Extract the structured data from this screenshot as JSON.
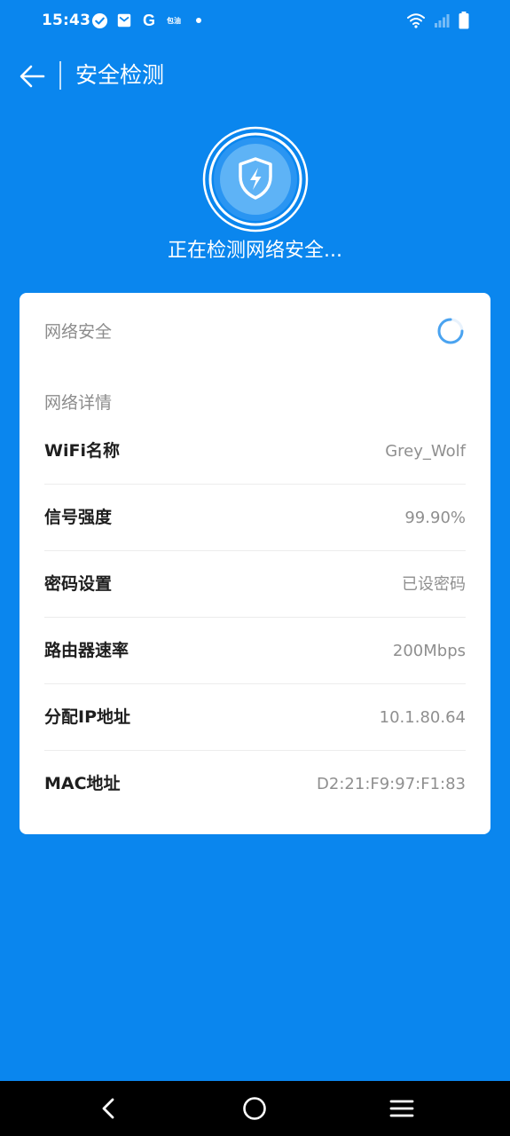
{
  "status_bar": {
    "time": "15:43",
    "notif_g_letter": "G",
    "notif_small_text": "包油"
  },
  "header": {
    "title": "安全检测"
  },
  "hero": {
    "message": "正在检测网络安全..."
  },
  "card": {
    "network_security_label": "网络安全",
    "network_details_label": "网络详情",
    "rows": [
      {
        "label": "WiFi名称",
        "value": "Grey_Wolf"
      },
      {
        "label": "信号强度",
        "value": "99.90%"
      },
      {
        "label": "密码设置",
        "value": "已设密码"
      },
      {
        "label": "路由器速率",
        "value": "200Mbps"
      },
      {
        "label": "分配IP地址",
        "value": "10.1.80.64"
      },
      {
        "label": "MAC地址",
        "value": "D2:21:F9:97:F1:83"
      }
    ]
  },
  "colors": {
    "background": "#0a86ee",
    "card": "#ffffff",
    "spinner": "#4aa3f0"
  },
  "icons": {
    "back": "arrow-left-icon",
    "shield": "shield-bolt-icon",
    "nav_back": "chevron-left-icon",
    "nav_home": "circle-home-icon",
    "nav_menu": "hamburger-menu-icon"
  }
}
